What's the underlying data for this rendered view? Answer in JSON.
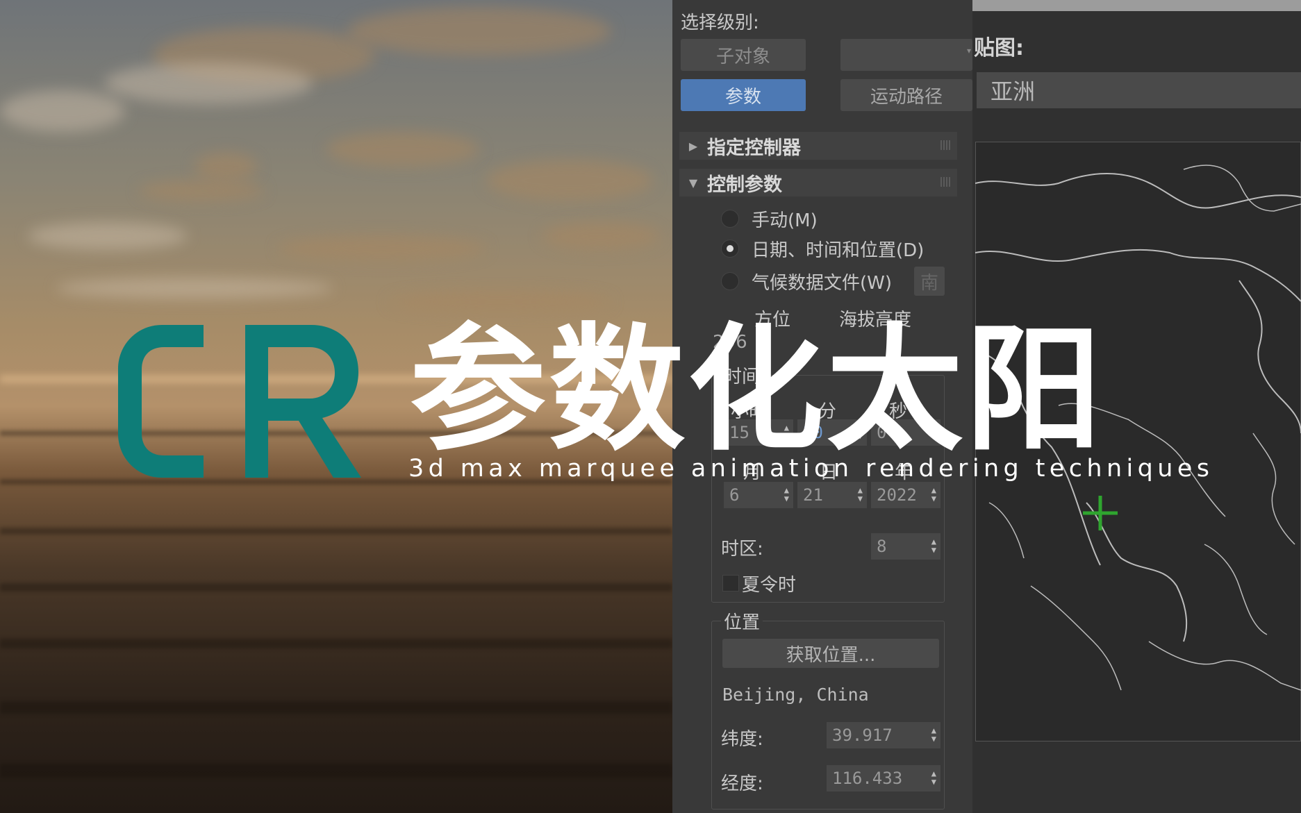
{
  "overlay": {
    "logo_text": "CR",
    "title": "参数化太阳",
    "subtitle": "3d max marquee animation rendering techniques"
  },
  "panel": {
    "select_level_label": "选择级别:",
    "sub_object_button": "子对象",
    "parameters_button": "参数",
    "motion_path_button": "运动路径",
    "assign_controller_rollout": "指定控制器",
    "control_params_rollout": "控制参数",
    "radio_manual": "手动(M)",
    "radio_datetime": "日期、时间和位置(D)",
    "radio_weather": "气候数据文件(W)",
    "weather_side_label": "南",
    "azimuth_label": "方位",
    "altitude_label": "海拔高度",
    "azimuth_value": "296",
    "time_group_label": "时间",
    "hour_label": "小时",
    "minute_label": "分",
    "second_label": "秒",
    "hour_value": "15",
    "minute_value": "20",
    "second_value": "0",
    "month_label": "月",
    "day_label": "日",
    "year_label": "年",
    "month_value": "6",
    "day_value": "21",
    "year_value": "2022",
    "timezone_label": "时区:",
    "timezone_value": "8",
    "dst_label": "夏令时",
    "location_group_label": "位置",
    "get_location_button": "获取位置...",
    "location_name": "Beijing, China",
    "latitude_label": "纬度:",
    "latitude_value": "39.917",
    "longitude_label": "经度:",
    "longitude_value": "116.433",
    "active_button_color": "#4d79b4"
  },
  "map": {
    "map_label": "贴图:",
    "region_value": "亚洲",
    "marker_color": "#2fa52f"
  },
  "colors": {
    "logo": "#0e7d78",
    "panel_bg": "#393939"
  }
}
